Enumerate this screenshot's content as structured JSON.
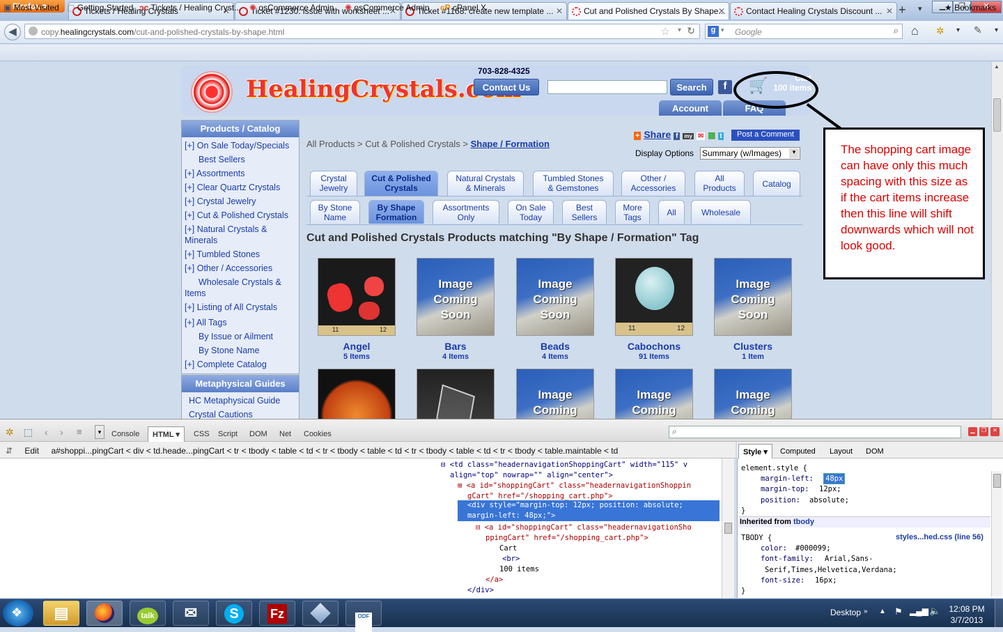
{
  "browser": {
    "app_button": "Firefox",
    "tabs": [
      {
        "label": "Tickets / Healing Crystals"
      },
      {
        "label": "Ticket #1230: issue with worksheet ..."
      },
      {
        "label": "Ticket #1168: create new template ..."
      },
      {
        "label": "Cut and Polished Crystals By Shape..."
      },
      {
        "label": "Contact Healing Crystals Discount ..."
      }
    ],
    "new_tab": "+",
    "url_prefix": "copy.",
    "url_host": "healingcrystals.com",
    "url_path": "/cut-and-polished-crystals-by-shape.html",
    "search_placeholder": "Google",
    "bookmarks": [
      "Most Visited",
      "Getting Started",
      "Tickets / Healing Cryst...",
      "osCommerce Admin",
      "osCommerce Admin",
      "cPanel X"
    ],
    "bookmarks_menu": "Bookmarks"
  },
  "site": {
    "logo": "HealingCrystals.com",
    "phone": "703-828-4325",
    "contact_btn": "Contact Us",
    "search_btn": "Search",
    "facebook": "f",
    "cart_line1": "Cart",
    "cart_line2": "100 items",
    "account_tab": "Account",
    "faq_tab": "FAQ"
  },
  "sidebar": {
    "heading": "Products / Catalog",
    "items": [
      "[+] On Sale Today/Specials",
      "Best Sellers",
      "[+] Assortments",
      "[+] Clear Quartz Crystals",
      "[+] Crystal Jewelry",
      "[+] Cut & Polished Crystals",
      "[+] Natural Crystals &",
      "Minerals",
      "[+] Tumbled Stones",
      "[+] Other / Accessories",
      "Wholesale Crystals &",
      "Items",
      "[+] Listing of All Crystals",
      "[+] All Tags",
      "By Issue or Ailment",
      "By Stone Name",
      "[+] Complete Catalog"
    ],
    "heading2": "Metaphysical Guides",
    "items2": [
      "HC Metaphysical Guide",
      "Crystal Cautions"
    ]
  },
  "main": {
    "crumbs": [
      "All Products",
      "Cut & Polished Crystals",
      "Shape / Formation"
    ],
    "crumb_sep": " > ",
    "share": "Share",
    "post_comment": "Post a Comment",
    "display_options": "Display Options",
    "display_value": "Summary (w/Images)",
    "tabs_row1": [
      {
        "l1": "Crystal",
        "l2": "Jewelry"
      },
      {
        "l1": "Cut & Polished",
        "l2": "Crystals"
      },
      {
        "l1": "Natural Crystals",
        "l2": "& Minerals"
      },
      {
        "l1": "Tumbled Stones",
        "l2": "& Gemstones"
      },
      {
        "l1": "Other /",
        "l2": "Accessories"
      },
      {
        "l1": "All",
        "l2": "Products"
      },
      {
        "l1": "Catalog",
        "l2": ""
      }
    ],
    "tabs_row2": [
      {
        "l1": "By Stone",
        "l2": "Name"
      },
      {
        "l1": "By Shape",
        "l2": "Formation"
      },
      {
        "l1": "Assortments",
        "l2": "Only"
      },
      {
        "l1": "On Sale",
        "l2": "Today"
      },
      {
        "l1": "Best",
        "l2": "Sellers"
      },
      {
        "l1": "More",
        "l2": "Tags"
      },
      {
        "l1": "All",
        "l2": ""
      },
      {
        "l1": "Wholesale",
        "l2": ""
      }
    ],
    "title": "Cut and Polished Crystals Products matching \"By Shape / Formation\" Tag",
    "coming_soon": [
      "Image",
      "Coming",
      "Soon"
    ],
    "products": [
      {
        "name": "Angel",
        "count": "5 Items"
      },
      {
        "name": "Bars",
        "count": "4 Items"
      },
      {
        "name": "Beads",
        "count": "4 Items"
      },
      {
        "name": "Cabochons",
        "count": "91 Items"
      },
      {
        "name": "Clusters",
        "count": "1 Item"
      }
    ],
    "ruler_left": [
      "11",
      "12"
    ],
    "ruler_right": [
      "11",
      "12"
    ]
  },
  "annotation": {
    "text": "The shopping cart image can have only this much spacing with this size as if the cart items increase then this line will shift downwards which will not look good."
  },
  "firebug": {
    "tabs": [
      "Console",
      "HTML",
      "CSS",
      "Script",
      "DOM",
      "Net",
      "Cookies"
    ],
    "edit": "Edit",
    "crumbs": "a#shoppi...pingCart < div < td.heade...pingCart < tr < tbody < table < td < tr < tbody < table < td < tr < tbody < table < td < tr < tbody < table.maintable < td",
    "html_lines": [
      "<td class=\"headernavigationShoppingCart\" width=\"115\" v",
      "align=\"top\" nowrap=\"\" align=\"center\">",
      "<a id=\"shoppingCart\" class=\"headernavigationShoppin",
      "gCart\" href=\"/shopping_cart.php\">",
      "<div style=\"margin-top: 12px; position: absolute;",
      "margin-left: 48px;\">",
      "<a id=\"shoppingCart\" class=\"headernavigationSho",
      "ppingCart\" href=\"/shopping_cart.php\">",
      "Cart",
      "<br>",
      "100 items",
      "</a>",
      "</div>"
    ],
    "style_tabs": [
      "Style",
      "Computed",
      "Layout",
      "DOM"
    ],
    "element_style": "element.style {",
    "rules": [
      "margin-left:",
      "48px",
      "margin-top:",
      "12px;",
      "position:",
      "absolute;"
    ],
    "close_brace": "}",
    "inherited": "Inherited from",
    "inherited_from": "tbody",
    "tbody_sel": "TBODY {",
    "tbody_src": "styles...hed.css (line 56)",
    "tbody_rules": [
      "color:",
      "#000099;",
      "font-family:",
      "Arial,Sans-",
      "Serif,Times,Helvetica,Verdana;",
      "font-size:",
      "16px;"
    ]
  },
  "taskbar": {
    "desktop": "Desktop",
    "time": "12:08 PM",
    "date": "3/7/2013",
    "apps": [
      "folder",
      "firefox",
      "talk",
      "thunderbird",
      "skype",
      "filezilla",
      "virtualbox",
      "odf"
    ]
  }
}
